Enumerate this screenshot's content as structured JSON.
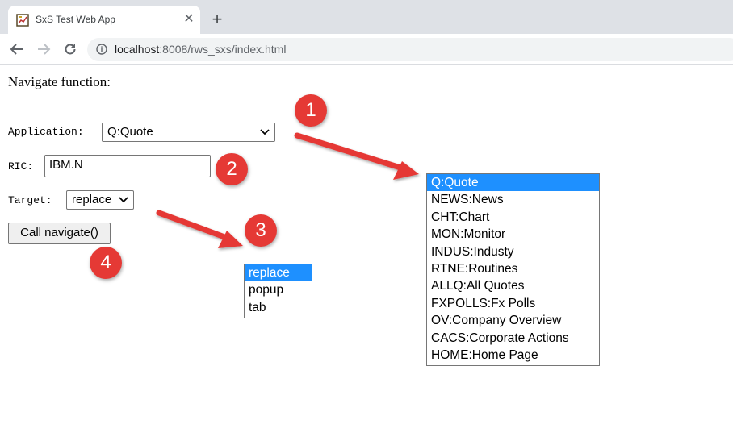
{
  "browser": {
    "tab_title": "SxS Test Web App",
    "new_tab_symbol": "+",
    "close_symbol": "✕",
    "url_host": "localhost",
    "url_rest": ":8008/rws_sxs/index.html"
  },
  "page": {
    "heading": "Navigate function:",
    "application_label": "Application:",
    "application_value": "Q:Quote",
    "ric_label": "RIC:",
    "ric_value": "IBM.N",
    "target_label": "Target:",
    "target_value": "replace",
    "call_button": "Call navigate()"
  },
  "application_options": [
    "Q:Quote",
    "NEWS:News",
    "CHT:Chart",
    "MON:Monitor",
    "INDUS:Industy",
    "RTNE:Routines",
    "ALLQ:All Quotes",
    "FXPOLLS:Fx Polls",
    "OV:Company Overview",
    "CACS:Corporate Actions",
    "HOME:Home Page"
  ],
  "target_options": [
    "replace",
    "popup",
    "tab"
  ],
  "callouts": [
    "1",
    "2",
    "3",
    "4"
  ],
  "colors": {
    "callout": "#e53935",
    "selection": "#1e90ff"
  }
}
